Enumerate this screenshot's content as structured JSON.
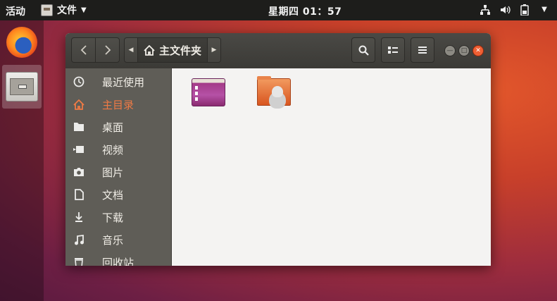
{
  "topbar": {
    "activities": "活动",
    "app_name": "文件",
    "clock": "星期四 01：57",
    "tray": [
      "network-icon",
      "volume-icon",
      "battery-icon",
      "dropdown-arrow-icon"
    ]
  },
  "dock": {
    "items": [
      {
        "name": "firefox-icon"
      },
      {
        "name": "files-icon",
        "active": true
      }
    ]
  },
  "window": {
    "path_label": "主文件夹",
    "sidebar": {
      "items": [
        {
          "label": "最近使用",
          "icon": "clock-icon"
        },
        {
          "label": "主目录",
          "icon": "home-icon",
          "active": true
        },
        {
          "label": "桌面",
          "icon": "folder-icon"
        },
        {
          "label": "视频",
          "icon": "video-icon"
        },
        {
          "label": "图片",
          "icon": "camera-icon"
        },
        {
          "label": "文档",
          "icon": "document-icon"
        },
        {
          "label": "下载",
          "icon": "download-icon"
        },
        {
          "label": "音乐",
          "icon": "music-icon"
        },
        {
          "label": "回收站",
          "icon": "trash-icon"
        }
      ]
    },
    "content": {
      "items": [
        {
          "icon": "desktop-folder-icon"
        },
        {
          "icon": "public-folder-icon"
        }
      ]
    }
  },
  "colors": {
    "accent": "#ef7a45",
    "close": "#ef5f33",
    "topbar": "#1d1d1b",
    "sidebar": "#5f5d57"
  }
}
